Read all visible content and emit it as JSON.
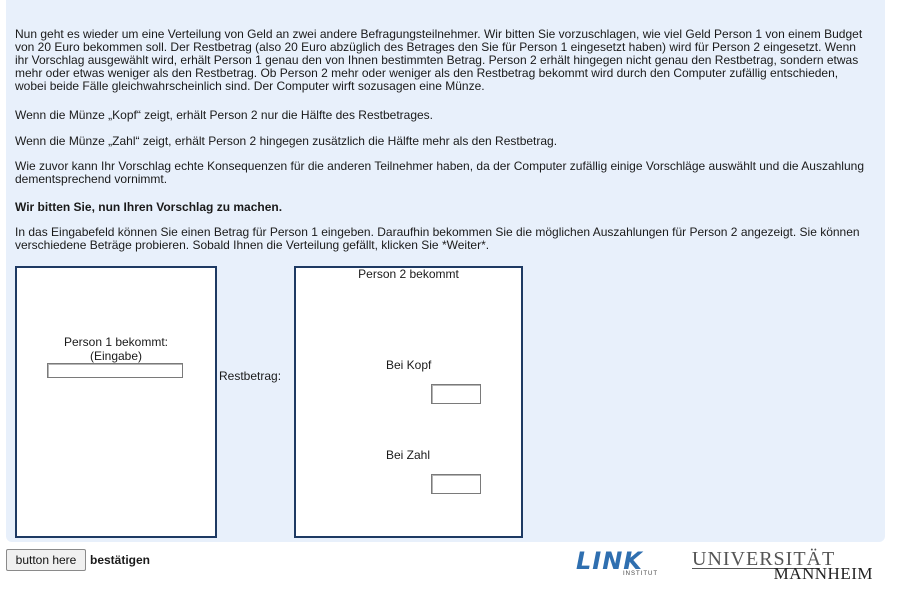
{
  "intro": {
    "p1": "Nun geht es wieder um eine Verteilung von Geld an zwei andere Befragungsteilnehmer. Wir bitten Sie vorzuschlagen, wie viel Geld Person 1 von einem Budget von 20 Euro bekommen soll. Der Restbetrag (also 20 Euro abzüglich des Betrages den Sie für Person 1 eingesetzt haben) wird für Person 2 eingesetzt. Wenn ihr Vorschlag ausgewählt wird, erhält Person 1 genau den von Ihnen bestimmten Betrag. Person 2 erhält hingegen nicht genau den Restbetrag, sondern etwas mehr oder etwas weniger als den Restbetrag. Ob Person 2 mehr oder weniger als den Restbetrag bekommt wird durch den Computer zufällig entschieden, wobei beide Fälle gleichwahrscheinlich sind. Der Computer wirft sozusagen eine Münze.",
    "p2": "Wenn die Münze „Kopf“ zeigt, erhält Person 2 nur die Hälfte des Restbetrages.",
    "p3": "Wenn die Münze „Zahl“ zeigt, erhält Person 2 hingegen zusätzlich die Hälfte mehr als den Restbetrag.",
    "p4": "Wie zuvor kann Ihr Vorschlag echte Konsequenzen für die anderen Teilnehmer haben, da der Computer zufällig einige Vorschläge auswählt und die Auszahlung dementsprechend vornimmt.",
    "p5": "Wir bitten Sie, nun Ihren Vorschlag zu machen.",
    "p6": "In das Eingabefeld können Sie einen Betrag für Person 1 eingeben. Daraufhin bekommen Sie die möglichen Auszahlungen für Person 2 angezeigt. Sie können verschiedene Beträge probieren. Sobald Ihnen die Verteilung gefällt, klicken Sie *Weiter*."
  },
  "person1": {
    "label": "Person 1 bekommt:",
    "sublabel": "(Eingabe)",
    "value": ""
  },
  "restbetrag_label": "Restbetrag:",
  "person2": {
    "title": "Person 2 bekommt",
    "kopf_label": "Bei Kopf",
    "kopf_value": "",
    "zahl_label": "Bei Zahl",
    "zahl_value": ""
  },
  "footer": {
    "button_label": "button here",
    "confirm_label": "bestätigen"
  },
  "logos": {
    "link_word": "LINK",
    "link_sub": "INSTITUT",
    "uni_top": "UNIVERSITÄT",
    "uni_bottom": "MANNHEIM"
  },
  "colors": {
    "panel_background": "#e8f0fb",
    "box_border": "#1e3a63",
    "link_blue": "#2f6fb0"
  }
}
